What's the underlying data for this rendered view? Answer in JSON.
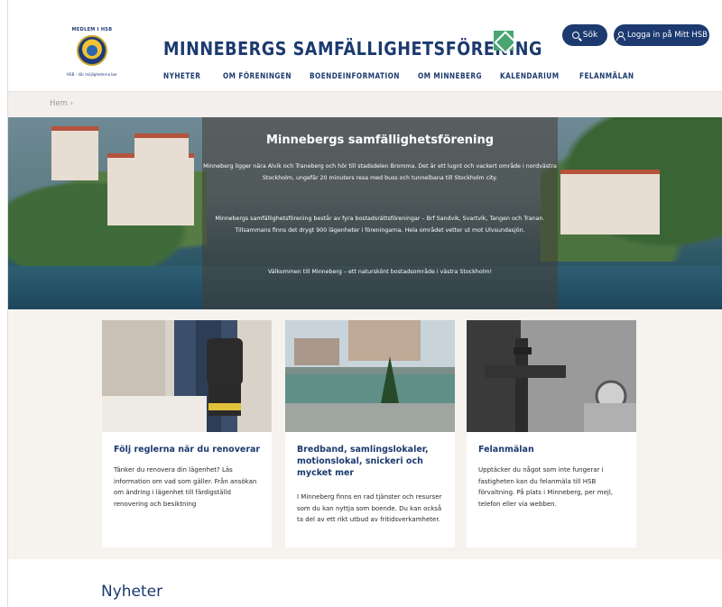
{
  "header": {
    "logo": {
      "top_text": "MEDLEM I HSB",
      "bottom_text": "HSB - där möjligheterna bor"
    },
    "site_title": "MINNEBERGS SAMFÄLLIGHETSFÖRENING",
    "search_button": "Sök",
    "login_button": "Logga in på Mitt HSB",
    "nav": [
      "NYHETER",
      "OM FÖRENINGEN",
      "BOENDEINFORMATION",
      "OM MINNEBERG",
      "KALENDARIUM",
      "FELANMÄLAN"
    ]
  },
  "breadcrumb": "Hem  ›",
  "hero": {
    "title": "Minnebergs samfällighetsförening",
    "paragraph1": "Minneberg ligger nära Alvik och Traneberg och hör till stadsdelen Bromma. Det är ett lugnt och vackert område i nordvästra Stockholm, ungefär 20 minuters resa med buss och tunnelbana till Stockholm city.",
    "paragraph2": "Minnebergs samfällighetsförening består av fyra bostadsrättsföreningar – Brf Sandvik, Svartvik, Tangen och Tranan. Tillsammans finns det drygt 900 lägenheter i föreningarna. Hela området vetter ut mot Ulvsundasjön.",
    "paragraph3": "Välkommen till Minneberg – ett naturskönt bostadsområde i västra Stockholm!"
  },
  "cards": [
    {
      "title": "Följ reglerna när du renoverar",
      "text": "Tänker du renovera din lägenhet? Läs information om vad som gäller. Från ansökan om ändring i lägenhet till färdigställd renovering och besiktning"
    },
    {
      "title": "Bredband, samlingslokaler, motionslokal, snickeri och mycket mer",
      "text": "I Minneberg finns en rad tjänster och resurser som du kan nyttja som boende. Du kan också ta del av ett rikt utbud av fritidsverkamheter."
    },
    {
      "title": "Felanmälan",
      "text": "Upptäcker du något som inte fungerar i fastigheten kan du felanmäla till HSB förvaltning. På plats i Minneberg, per mejl, telefon eller via webben."
    }
  ],
  "news_heading": "Nyheter",
  "colors": {
    "brand_navy": "#1c3a6f",
    "accent_green": "#4aa573",
    "page_background": "#f6f3ef"
  }
}
